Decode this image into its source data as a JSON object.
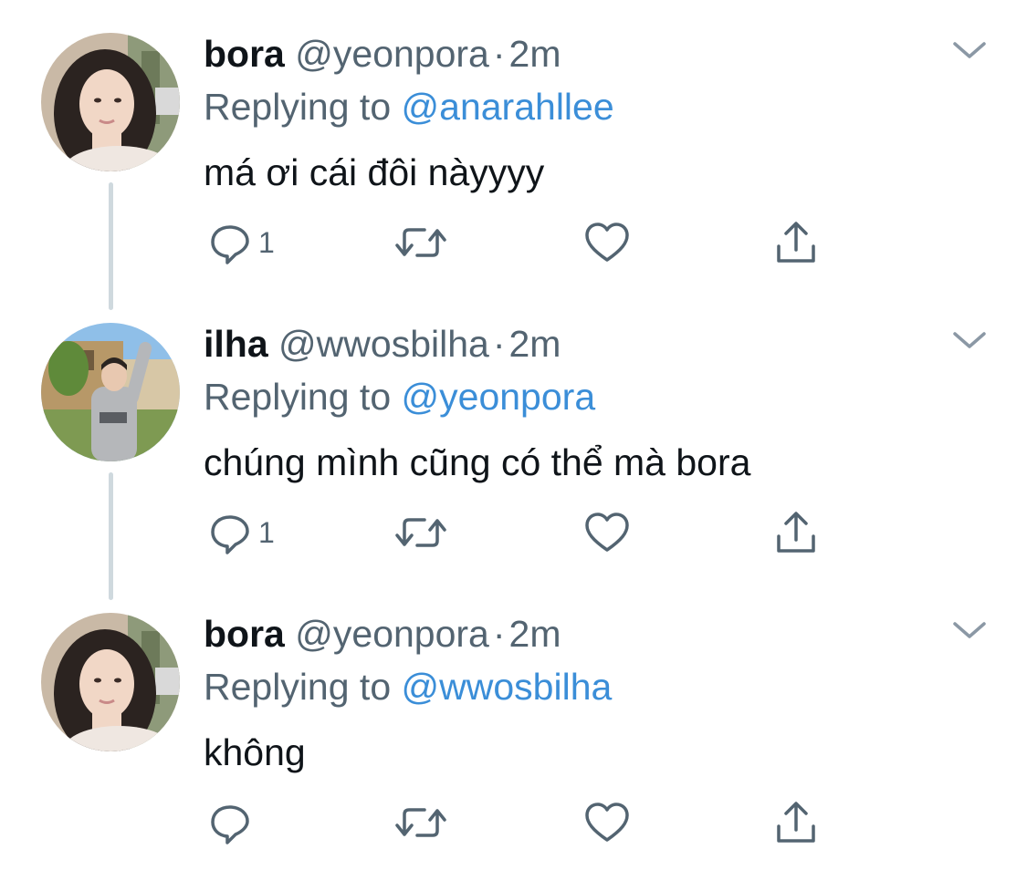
{
  "colors": {
    "text": "#0f1419",
    "secondary": "#536471",
    "link": "#3b8ed8",
    "thread_line": "#cfd9de"
  },
  "tweets": [
    {
      "name": "bora",
      "handle": "@yeonpora",
      "separator": "·",
      "time": "2m",
      "replying_label": "Replying to",
      "replying_to": "@anarahllee",
      "text": "má ơi cái đôi nàyyyy",
      "reply_count": "1",
      "avatar": "bora-avatar"
    },
    {
      "name": "ilha",
      "handle": "@wwosbilha",
      "separator": "·",
      "time": "2m",
      "replying_label": "Replying to",
      "replying_to": "@yeonpora",
      "text": "chúng mình cũng có thể mà bora",
      "reply_count": "1",
      "avatar": "ilha-avatar"
    },
    {
      "name": "bora",
      "handle": "@yeonpora",
      "separator": "·",
      "time": "2m",
      "replying_label": "Replying to",
      "replying_to": "@wwosbilha",
      "text": "không",
      "reply_count": "",
      "avatar": "bora-avatar"
    }
  ],
  "icons": [
    "reply-icon",
    "retweet-icon",
    "like-icon",
    "share-icon",
    "chevron-down-icon"
  ]
}
